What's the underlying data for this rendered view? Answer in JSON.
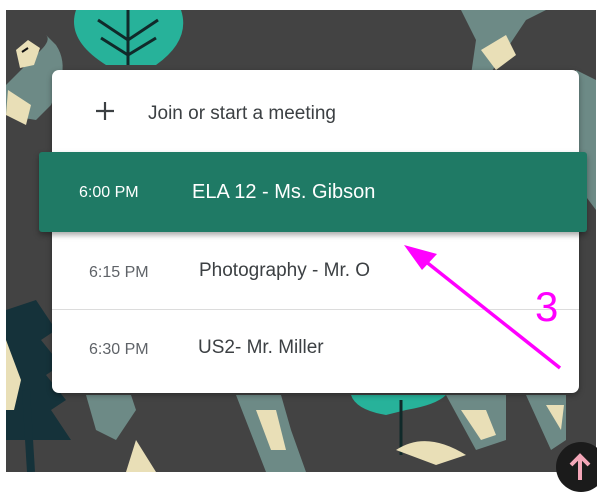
{
  "meetings_panel": {
    "join_label": "Join or start a meeting",
    "items": [
      {
        "time": "6:00 PM",
        "title": "ELA 12 - Ms. Gibson",
        "selected": true
      },
      {
        "time": "6:15 PM",
        "title": "Photography - Mr. O",
        "selected": false
      },
      {
        "time": "6:30 PM",
        "title": "US2- Mr. Miller",
        "selected": false
      }
    ]
  },
  "annotation": {
    "number": "3",
    "color": "#ff00ff"
  },
  "colors": {
    "accent": "#1f7a65",
    "background": "#434343"
  }
}
